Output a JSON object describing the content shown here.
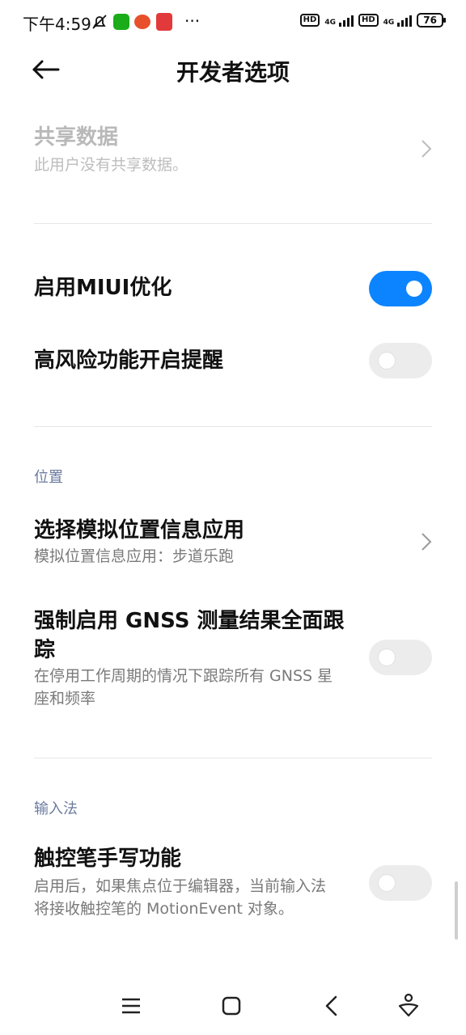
{
  "status_bar": {
    "time": "下午4:59",
    "more": "···",
    "hd1": "HD",
    "net1": "4G",
    "hd2": "HD",
    "net2": "4G",
    "battery": "76"
  },
  "header": {
    "title": "开发者选项"
  },
  "items": {
    "shared_data": {
      "title": "共享数据",
      "subtitle": "此用户没有共享数据。"
    },
    "miui_opt": {
      "title": "启用MIUI优化",
      "enabled": true
    },
    "risk_alert": {
      "title": "高风险功能开启提醒",
      "enabled": false
    },
    "mock_location": {
      "title": "选择模拟位置信息应用",
      "subtitle": "模拟位置信息应用：步道乐跑"
    },
    "gnss": {
      "title_line1": "强制启用 GNSS 测量结果全面跟",
      "title_line2": "踪",
      "subtitle_line1": "在停用工作周期的情况下跟踪所有 GNSS 星",
      "subtitle_line2": "座和频率",
      "enabled": false
    },
    "stylus": {
      "title": "触控笔手写功能",
      "subtitle_line1": "启用后，如果焦点位于编辑器，当前输入法",
      "subtitle_line2": "将接收触控笔的 MotionEvent 对象。",
      "enabled": false
    }
  },
  "sections": {
    "location": "位置",
    "input_method": "输入法"
  },
  "colors": {
    "accent": "#0d84ff",
    "section": "#6b7aa0"
  }
}
